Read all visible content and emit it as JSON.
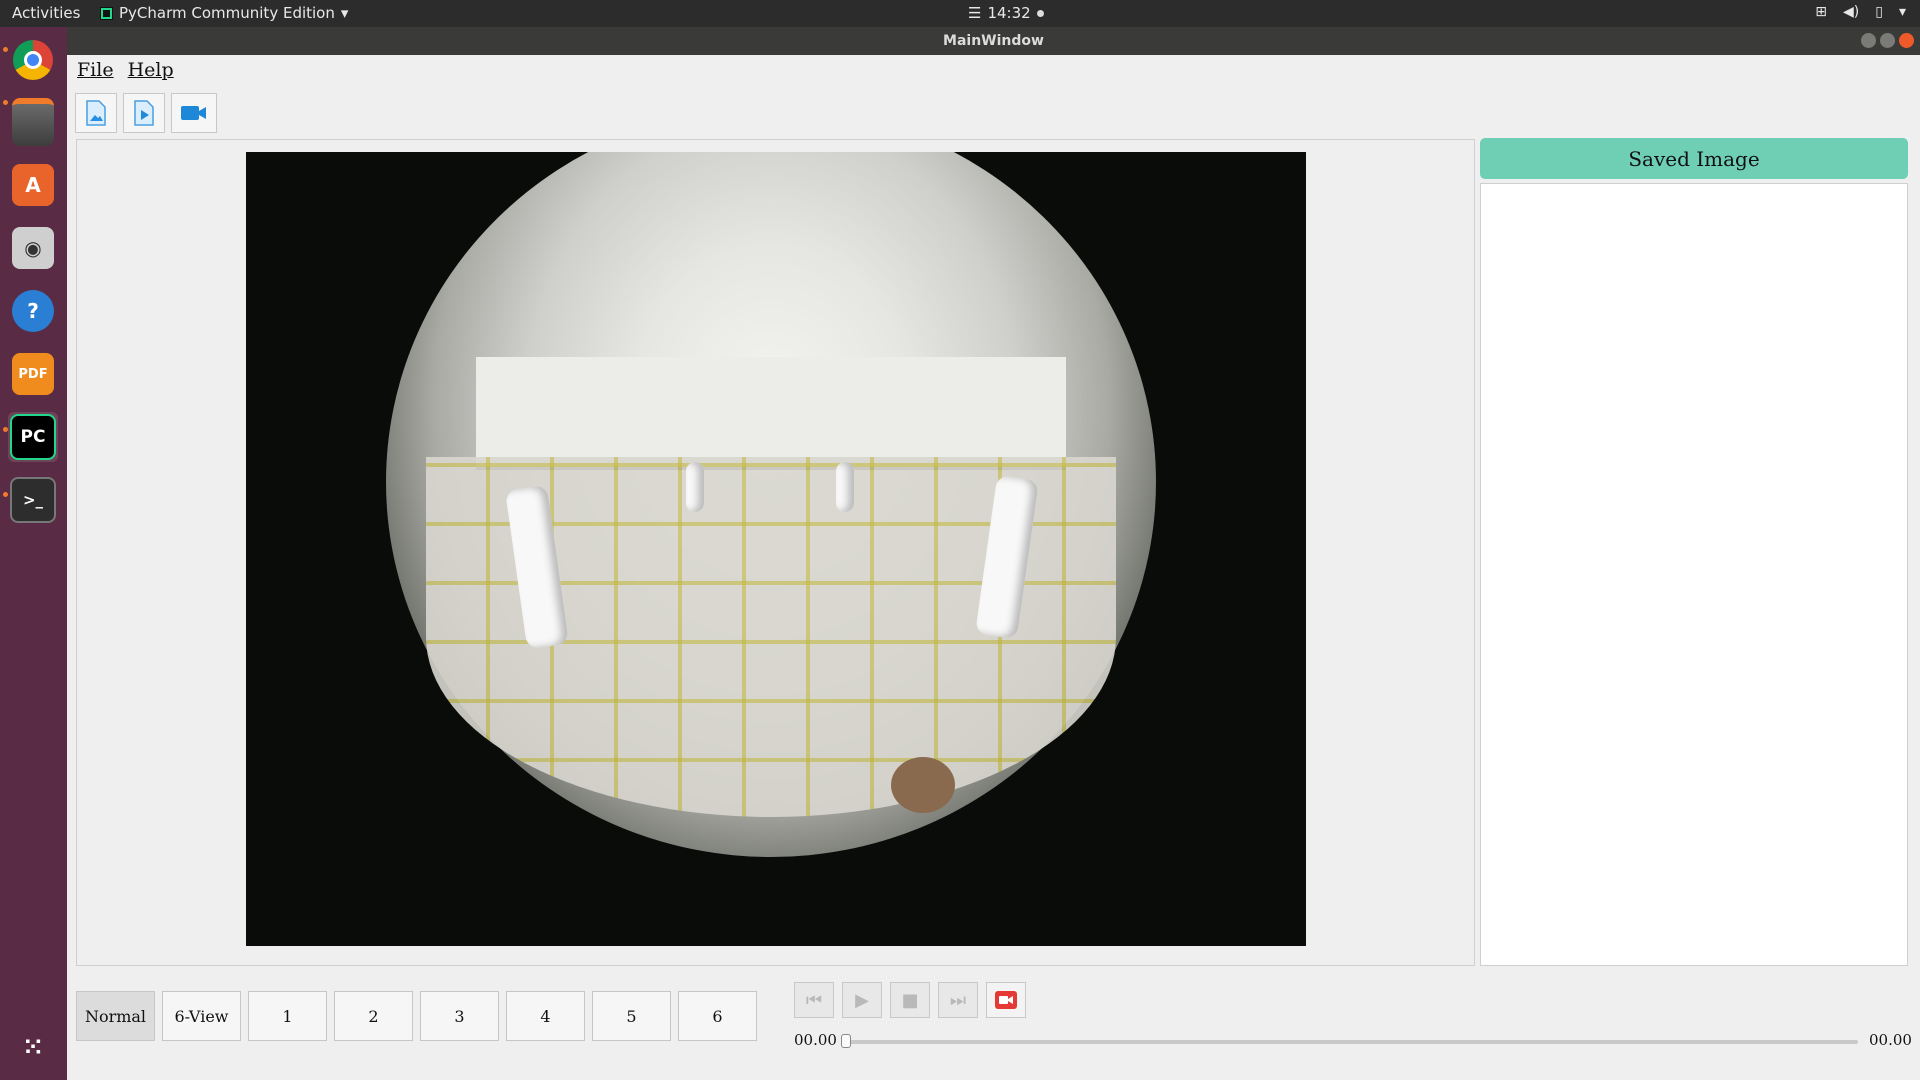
{
  "topbar": {
    "activities": "Activities",
    "app_name": "PyCharm Community Edition",
    "clock": "14:32"
  },
  "window": {
    "title": "MainWindow"
  },
  "menu": {
    "file": "File",
    "help": "Help"
  },
  "toolbar": {
    "buttons": [
      {
        "icon": "open-image-icon"
      },
      {
        "icon": "open-video-icon"
      },
      {
        "icon": "camera-icon"
      }
    ]
  },
  "saved_panel": {
    "title": "Saved Image"
  },
  "view_buttons": [
    "Normal",
    "6-View",
    "1",
    "2",
    "3",
    "4",
    "5",
    "6"
  ],
  "active_view": "Normal",
  "playback": {
    "time_start": "00.00",
    "time_end": "00.00",
    "progress": 0
  },
  "colors": {
    "saved_header": "#6ecfb5",
    "dock": "#5a2b44",
    "record": "#e53935"
  }
}
